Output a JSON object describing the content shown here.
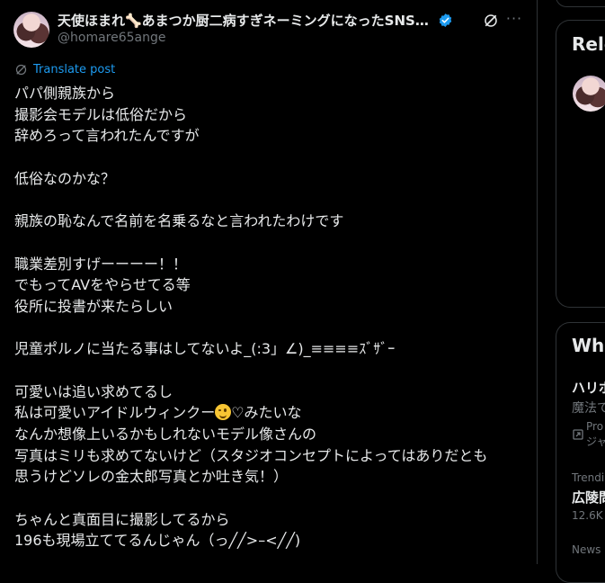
{
  "post": {
    "display_name": "天使ほまれ🦴あまつか厨二病すぎネーミングになったSNS総フ…",
    "handle": "@homare65ange",
    "translate_label": "Translate post",
    "more_label": "···",
    "lines": [
      "パパ側親族から",
      "撮影会モデルは低俗だから",
      "辞めろって言われたんですが",
      "",
      "低俗なのかな？",
      "",
      "親族の恥なんで名前を名乗るなと言われたわけです",
      "",
      "職業差別すげーーーー！！",
      "でもってAVをやらせてる等",
      "役所に投書が来たらしい",
      "",
      "児童ポルノに当たる事はしてないよ_(:3」∠)_≡≡≡≡ｽﾞｻﾞｰ",
      "",
      "可愛いは追い求めてるし",
      "私は可愛いアイドルウィンクー",
      "なんか想像上いるかもしれないモデル像さんの",
      "写真はミリも求めてないけど（スタジオコンセプトによってはありだとも",
      "思うけどソレの金太郎写真とか吐き気！）",
      "",
      "ちゃんと真面目に撮影してるから",
      "196も現場立ててるんじゃん（っ╱╱>–<╱╱)"
    ],
    "emoji_line_suffix": "♡みたいな",
    "emoji_name": "winking-face"
  },
  "sidebar": {
    "related_title": "Rele",
    "whats_title": "Wha",
    "trends": [
      {
        "title": "ハリポ",
        "sub": "魔法で",
        "promo": "Pro",
        "promo2": "ジャ"
      },
      {
        "category": "Trendi",
        "title": "広陵問",
        "count": "12.6K"
      },
      {
        "category": "News"
      }
    ]
  },
  "colors": {
    "background": "#000000",
    "text": "#e7e9ea",
    "muted": "#71767b",
    "accent": "#1d9bf0",
    "border": "#2f3336"
  }
}
